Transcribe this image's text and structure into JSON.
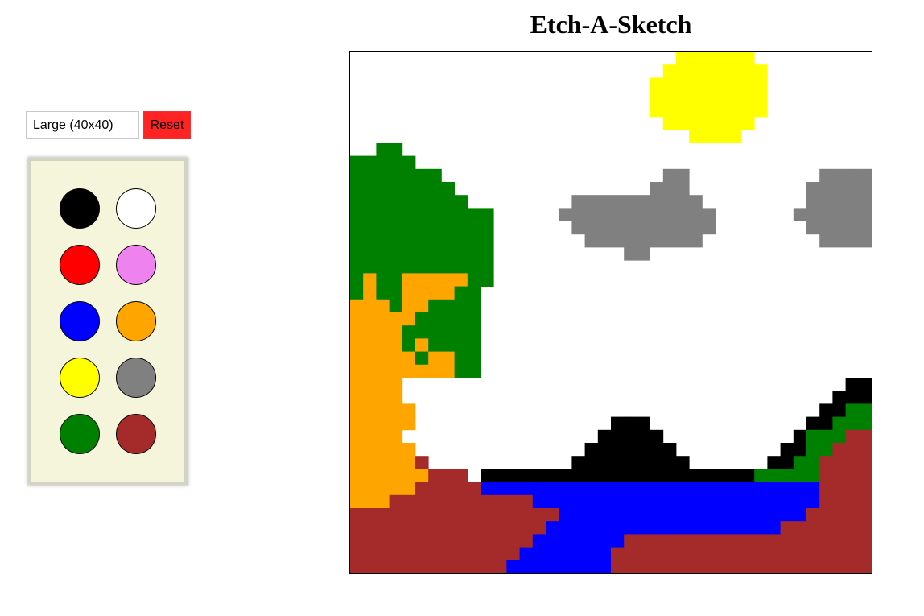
{
  "header": {
    "title": "Etch-A-Sketch"
  },
  "controls": {
    "size_value": "Large (40x40)",
    "reset_label": "Reset"
  },
  "palette": {
    "colors": [
      "#000000",
      "#ffffff",
      "#ff0000",
      "#ee82ee",
      "#0000ff",
      "#ffa500",
      "#ffff00",
      "#808080",
      "#008000",
      "#a52a2a"
    ],
    "names": [
      "black",
      "white",
      "red",
      "violet",
      "blue",
      "orange",
      "yellow",
      "gray",
      "green",
      "brown"
    ]
  },
  "grid": {
    "cells_per_side": 40,
    "legend": {
      "W": "#ffffff",
      "Y": "#ffff00",
      "G": "#008000",
      "O": "#ffa500",
      "A": "#808080",
      "K": "#000000",
      "B": "#0000ff",
      "R": "#a52a2a"
    },
    "rows": [
      "WWWWWWWWWWWWWWWWWWWWWWWWWYYYYYYWWWWWWWWW",
      "WWWWWWWWWWWWWWWWWWWWWWWWYYYYYYYYWWWWWWWW",
      "WWWWWWWWWWWWWWWWWWWWWWWYYYYYYYYYWWWWWWWW",
      "WWWWWWWWWWWWWWWWWWWWWWWYYYYYYYYYWWWWWWWW",
      "WWWWWWWWWWWWWWWWWWWWWWWYYYYYYYYYWWWWWWWW",
      "WWWWWWWWWWWWWWWWWWWWWWWWYYYYYYYWWWWWWWWW",
      "WWWWWWWWWWWWWWWWWWWWWWWWWWYYYYWWWWWWWWWW",
      "WWGGWWWWWWWWWWWWWWWWWWWWWWWWWWWWWWWWWWWW",
      "GGGGGWWWWWWWWWWWWWWWWWWWWWWWWWWWWWWWWWWW",
      "GGGGGGGWWWWWWWWWWWWWWWWWAAWWWWWWWWWWAAAAA",
      "GGGGGGGGWWWWWWWWWWWWWWWAAAWWWWWWWWWAAAAAA",
      "GGGGGGGGGWWWWWWWWAAAAAAAAAAWWWWWWWWAAAAAA",
      "GGGGGGGGGGGWWWWWAAAAAAAAAAAAWWWWWWAAAAAAA",
      "GGGGGGGGGGGWWWWWWAAAAAAAAAAAWWWWWWWAAAAAA",
      "GGGGGGGGGGGWWWWWWWAAAAAAAAAWWWWWWWWWAAAAA",
      "GGGGGGGGGGGWWWWWWWWWWAAWWWWWWWWWWWWWWWWWW",
      "GGGGGGGGGGGWWWWWWWWWWWWWWWWWWWWWWWWWWWWWW",
      "GOGGOOOOOGGWWWWWWWWWWWWWWWWWWWWWWWWWWWWWW",
      "GOGGOOOOGGWWWWWWWWWWWWWWWWWWWWWWWWWWWWWWWW",
      "OOOGOOGGGGWWWWWWWWWWWWWWWWWWWWWWWWWWWWWWWW",
      "OOOOOGGGGGWWWWWWWWWWWWWWWWWWWWWWWWWWWWWWWW",
      "OOOOGGGGGGWWWWWWWWWWWWWWWWWWWWWWWWWWWWWWWW",
      "OOOOGOGGGGWWWWWWWWWWWWWWWWWWWWWWWWWWWWWWWW",
      "OOOOOGOOGGWWWWWWWWWWWWWWWWWWWWWWWWWWWWWWWW",
      "OOOOOOOOGGWWWWWWWWWWWWWWWWWWWWWWWWWWWWWWWW",
      "OOOOWWWWWWWWWWWWWWWWWWWWWWWWWWWWWWWWWWKKKK",
      "OOOOWWWWWWWWWWWWWWWWWWWWWWWWWWWWWWWWWKKKGG",
      "OOOOOWWWWWWWWWWWWWWWWWWWWWWWWWWWWWWWKKGGGR",
      "OOOOOWWWWWWWWWWWWWWWKKKWWWWWWWWWWWWKKGGGRR",
      "OOOOWWWWWWWWWWWWWWWKKKKKWWWWWWWWWWKGGGRRRR",
      "OOOOOWWWWWWWWWWWWWKKKKKKKWWWWWWWWKKGGRRRRR",
      "OOOOORWWWWWWWWWWWKKKKKKKKKWWWWWWKKGGRRRRRR",
      "OOOOOORRRWKKKKKKKKKKKKKKKKKKKKKGGGGGRRRRRR",
      "OOOOORRRRRBBBBBBBBBBBBBBBBBBBBBBBBBBRRRRRR",
      "OOORRRRRRRRRRRBBBBBBBBBBBBBBBBBBBBBBRRRRRR",
      "RRRRRRRRRRRRRRRRBBBBBBBBBBBBBBBBBBBRRRRRRR",
      "RRRRRRRRRRRRRRRBBBBBBBBBBBBBBBBBBRRRRRRRRR",
      "RRRRRRRRRRRRRRBBBBBBBRRRRRRRRRRRRRRRRRRRRR",
      "RRRRRRRRRRRRRBBBBBBBRRRRRRRRRRRRRRRRRRRRRR",
      "RRRRRRRRRRRRBBBBBBBBRRRRRRRRRRRRRRRRRRRRRR"
    ]
  }
}
